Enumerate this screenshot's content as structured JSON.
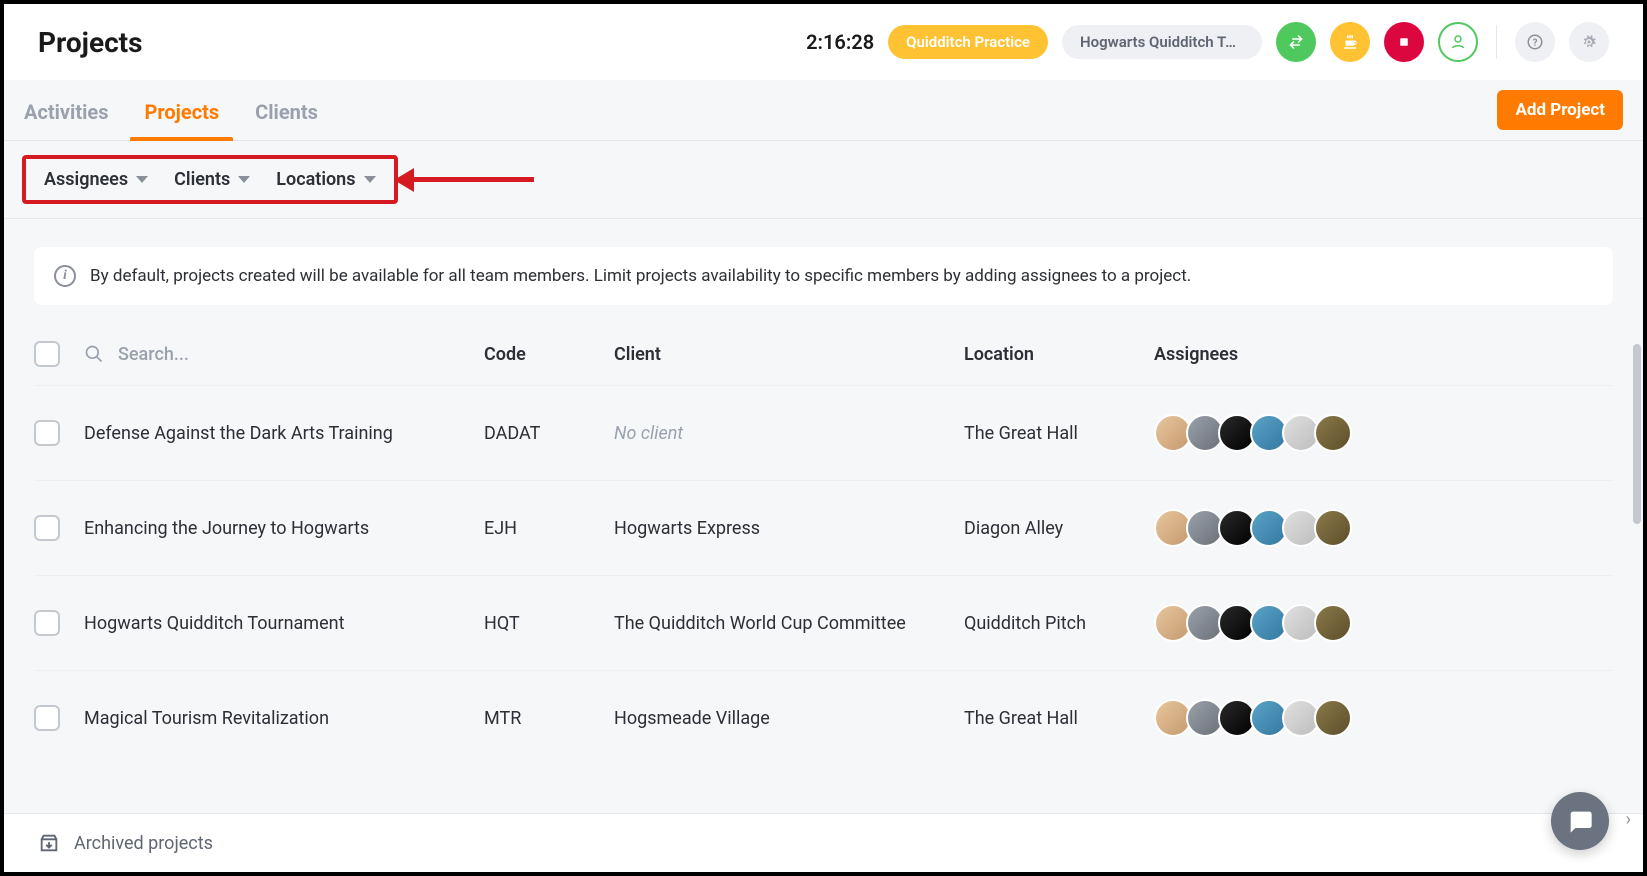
{
  "header": {
    "title": "Projects",
    "timer": "2:16:28",
    "pill_active": "Quidditch Practice",
    "pill_context": "Hogwarts Quidditch To..."
  },
  "tabs": {
    "items": [
      "Activities",
      "Projects",
      "Clients"
    ],
    "active_index": 1,
    "add_button": "Add Project"
  },
  "filters": {
    "items": [
      "Assignees",
      "Clients",
      "Locations"
    ]
  },
  "info_banner": "By default, projects created will be available for all team members. Limit projects availability to specific members by adding assignees to a project.",
  "table": {
    "search_placeholder": "Search...",
    "columns": {
      "code": "Code",
      "client": "Client",
      "location": "Location",
      "assignees": "Assignees"
    },
    "no_client_label": "No client",
    "rows": [
      {
        "name": "Defense Against the Dark Arts Training",
        "code": "DADAT",
        "client": null,
        "location": "The Great Hall"
      },
      {
        "name": "Enhancing the Journey to Hogwarts",
        "code": "EJH",
        "client": "Hogwarts Express",
        "location": "Diagon Alley"
      },
      {
        "name": "Hogwarts Quidditch Tournament",
        "code": "HQT",
        "client": "The Quidditch World Cup Committee",
        "location": "Quidditch Pitch"
      },
      {
        "name": "Magical Tourism Revitalization",
        "code": "MTR",
        "client": "Hogsmeade Village",
        "location": "The Great Hall"
      }
    ]
  },
  "footer": {
    "archived": "Archived projects"
  }
}
